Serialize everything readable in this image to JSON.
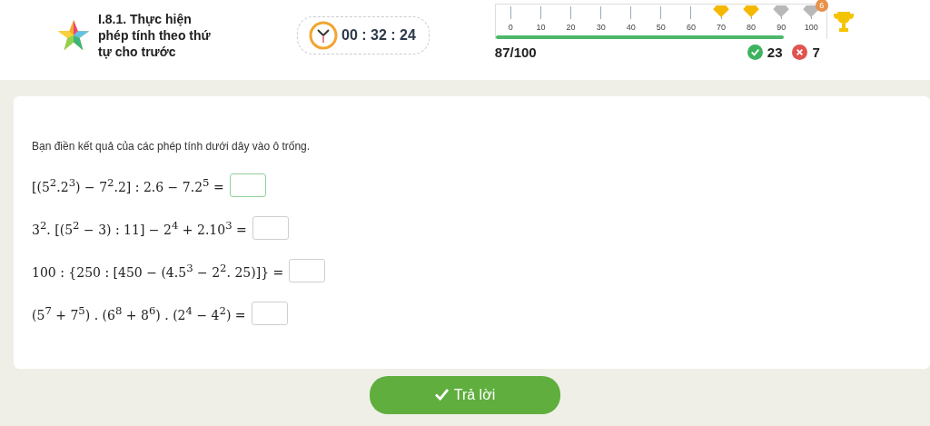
{
  "lesson": {
    "title": "I.8.1. Thực hiện phép tính theo thứ tự cho trước"
  },
  "timer": {
    "time": "00 : 32 : 24"
  },
  "progress": {
    "level": 0.87,
    "score": "87/100",
    "correct": "23",
    "wrong": "7",
    "ticks": [
      {
        "label": "0"
      },
      {
        "label": "10"
      },
      {
        "label": "20"
      },
      {
        "label": "30"
      },
      {
        "label": "40"
      },
      {
        "label": "50"
      },
      {
        "label": "60"
      },
      {
        "label": "70",
        "milestone": true,
        "reached": true
      },
      {
        "label": "80",
        "milestone": true,
        "reached": true
      },
      {
        "label": "90",
        "milestone": true,
        "reached": false
      },
      {
        "label": "100",
        "milestone": true,
        "reached": false,
        "badge": "6"
      }
    ]
  },
  "question": {
    "instruction": "Bạn điền kết quả của các phép tính dưới dây vào ô trống.",
    "items": [
      {
        "expression": "[(5$^{2}$.2$^{3}$) − 7$^{2}$.2] : 2.6 − 7.2$^{5}$ =",
        "focused": true
      },
      {
        "expression": "3$^{2}$. [(5$^{2}$ − 3) : 11] − 2$^{4}$ + 2.10$^{3}$ =",
        "focused": false
      },
      {
        "expression": "100 : {250 : [450 − (4.5$^{3}$ − 2$^{2}$. 25)]} =",
        "focused": false
      },
      {
        "expression": "(5$^{7}$ + 7$^{5}$) . (6$^{8}$ + 8$^{6}$) . (2$^{4}$ − 4$^{2}$) =",
        "focused": false
      }
    ]
  },
  "submit": {
    "label": "Trả lời"
  }
}
